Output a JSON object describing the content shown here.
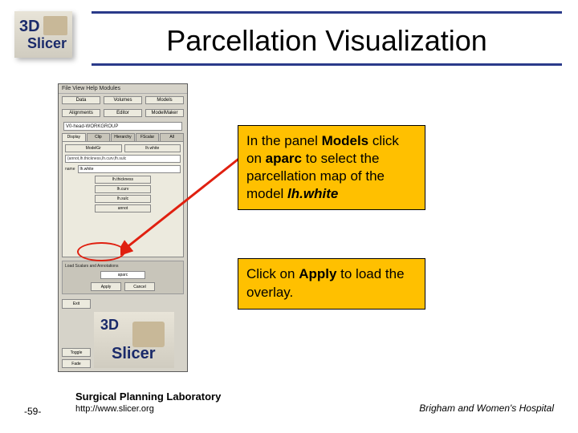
{
  "header": {
    "logo_line1": "3D",
    "logo_line2": "Slicer",
    "title": "Parcellation Visualization"
  },
  "app": {
    "menubar": "File  View  Help  Modules",
    "top_buttons": [
      "Data",
      "Volumes",
      "Models",
      "Alignments",
      "Editor",
      "ModelMaker"
    ],
    "dropdown_value": "V0-head-WORKGROUP",
    "tabs": [
      "Display",
      "Clip",
      "Hierarchy",
      "FScalar",
      "All"
    ],
    "panel": {
      "row1": [
        "ModelGr",
        "lh.white"
      ],
      "long_field": "{annot,lh.thickness,lh.curv,fh.sulc",
      "name_label": "name",
      "name_value": "lh.white",
      "stack": [
        "lh.thickness",
        "lh.curv",
        "lh.sulc",
        "annot"
      ]
    },
    "overlay": {
      "title": "Load Scalars and Annotations",
      "field": "aparc",
      "apply": "Apply",
      "cancel": "Cancel"
    },
    "exit_button": "Exit",
    "small_buttons": [
      "Toggle",
      "Fade"
    ],
    "minilogo_line1": "3D",
    "minilogo_line2": "Slicer"
  },
  "callouts": {
    "c1_pre": "In the panel ",
    "c1_b1": "Models",
    "c1_mid1": " click on ",
    "c1_b2": "aparc",
    "c1_mid2": " to select the parcellation map of the model ",
    "c1_it": "lh.white",
    "c2_pre": "Click on ",
    "c2_b": "Apply",
    "c2_post": " to load the overlay."
  },
  "footer": {
    "lab": "Surgical Planning Laboratory",
    "url": "http://www.slicer.org",
    "page": "-59-",
    "hospital": "Brigham and Women's Hospital"
  }
}
